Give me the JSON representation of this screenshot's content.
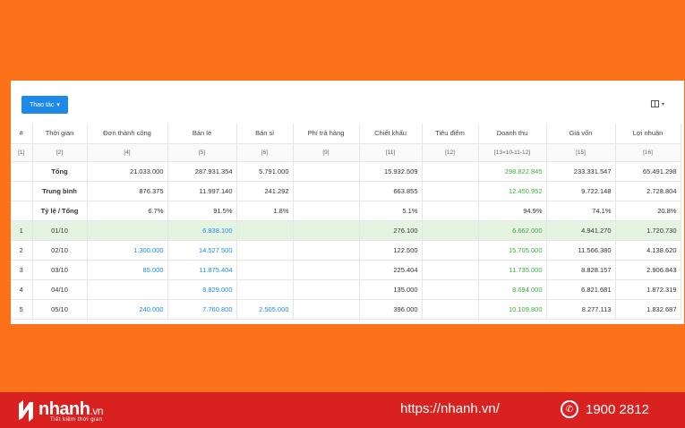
{
  "toolbar": {
    "action_label": "Thao tác",
    "chevron": "⌄"
  },
  "columns": [
    "#",
    "Thời gian",
    "Đơn thành công",
    "Bán lẻ",
    "Bán sỉ",
    "Phí trả hàng",
    "Chiết khấu",
    "Tiêu điểm",
    "Doanh thu",
    "Giá vốn",
    "Lợi nhuận"
  ],
  "indices": [
    "[1]",
    "[2]",
    "[4]",
    "[5]",
    "[6]",
    "[9]",
    "[11]",
    "[12]",
    "[13=10-11-12]",
    "[15]",
    "[16]"
  ],
  "summary": [
    {
      "label": "Tổng",
      "cells": [
        "21.033.000",
        "287.931.354",
        "5.791.000",
        "",
        "15.932.509",
        "",
        "298.822.845",
        "233.331.547",
        "65.491.298"
      ]
    },
    {
      "label": "Trung bình",
      "cells": [
        "876.375",
        "11.997.140",
        "241.292",
        "",
        "663.855",
        "",
        "12.450.952",
        "9.722.148",
        "2.728.804"
      ]
    },
    {
      "label": "Tỷ lệ / Tổng",
      "cells": [
        "6.7%",
        "91.5%",
        "1.8%",
        "",
        "5.1%",
        "",
        "94.9%",
        "74.1%",
        "20.8%"
      ]
    }
  ],
  "rows": [
    {
      "num": "1",
      "date": "01/10",
      "cells": [
        "",
        "6.938.100",
        "",
        "",
        "276.100",
        "",
        "6.662.000",
        "4.941.270",
        "1.720.730"
      ]
    },
    {
      "num": "2",
      "date": "02/10",
      "cells": [
        "1.300.000",
        "14.527.500",
        "",
        "",
        "122.500",
        "",
        "15.705.000",
        "11.566.380",
        "4.138.620"
      ]
    },
    {
      "num": "3",
      "date": "03/10",
      "cells": [
        "85.000",
        "11.875.404",
        "",
        "",
        "225.404",
        "",
        "11.735.000",
        "8.828.157",
        "2.906.843"
      ]
    },
    {
      "num": "4",
      "date": "04/10",
      "cells": [
        "",
        "8.829.000",
        "",
        "",
        "135.000",
        "",
        "8.694.000",
        "6.821.681",
        "1.872.319"
      ]
    },
    {
      "num": "5",
      "date": "05/10",
      "cells": [
        "240.000",
        "7.760.800",
        "2.505.000",
        "",
        "396.000",
        "",
        "10.109.800",
        "8.277.113",
        "1.832.687"
      ]
    }
  ],
  "footer": {
    "logo_text": "nhanh",
    "logo_tld": ".vn",
    "logo_tagline": "Tiết kiệm thời gian",
    "url": "https://nhanh.vn/",
    "phone": "1900 2812"
  },
  "colors": {
    "orange": "#fb7218",
    "red": "#d9221f",
    "blue": "#1d8ae8",
    "green": "#3faa3f",
    "highlight": "#e5f3e1"
  }
}
